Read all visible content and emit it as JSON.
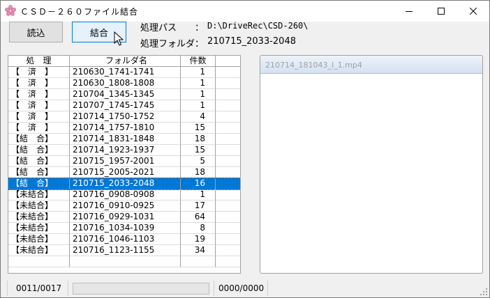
{
  "window": {
    "title": "ＣＳＤ－２６０ファイル結合",
    "icon": "sakura-flower-icon",
    "accent": "#0078d7"
  },
  "toolbar": {
    "load_label": "読込",
    "join_label": "結合"
  },
  "info": {
    "path_label": "処理パス　　：",
    "path_value": "D:\\DriveRec\\CSD-260\\",
    "folder_label": "処理フォルダ：",
    "folder_value": "210715_2033-2048"
  },
  "grid": {
    "headers": [
      "処　理",
      "フォルダ名",
      "件数",
      ""
    ],
    "selected_index": 10,
    "rows": [
      {
        "status": "【　済　】",
        "folder": "210630_1741-1741",
        "count": "1"
      },
      {
        "status": "【　済　】",
        "folder": "210630_1808-1808",
        "count": "1"
      },
      {
        "status": "【　済　】",
        "folder": "210704_1345-1345",
        "count": "1"
      },
      {
        "status": "【　済　】",
        "folder": "210707_1745-1745",
        "count": "1"
      },
      {
        "status": "【　済　】",
        "folder": "210714_1750-1752",
        "count": "4"
      },
      {
        "status": "【　済　】",
        "folder": "210714_1757-1810",
        "count": "15"
      },
      {
        "status": "【結　合】",
        "folder": "210714_1831-1848",
        "count": "18"
      },
      {
        "status": "【結　合】",
        "folder": "210714_1923-1937",
        "count": "15"
      },
      {
        "status": "【結　合】",
        "folder": "210715_1957-2001",
        "count": "5"
      },
      {
        "status": "【結　合】",
        "folder": "210715_2005-2021",
        "count": "18"
      },
      {
        "status": "【結　合】",
        "folder": "210715_2033-2048",
        "count": "16"
      },
      {
        "status": "【未結合】",
        "folder": "210716_0908-0908",
        "count": "1"
      },
      {
        "status": "【未結合】",
        "folder": "210716_0910-0925",
        "count": "17"
      },
      {
        "status": "【未結合】",
        "folder": "210716_0929-1031",
        "count": "64"
      },
      {
        "status": "【未結合】",
        "folder": "210716_1034-1039",
        "count": "8"
      },
      {
        "status": "【未結合】",
        "folder": "210716_1046-1103",
        "count": "19"
      },
      {
        "status": "【未結合】",
        "folder": "210716_1123-1155",
        "count": "34"
      },
      {
        "status": "",
        "folder": "",
        "count": ""
      }
    ]
  },
  "preview": {
    "title": "210714_181043_I_1.mp4"
  },
  "status": {
    "count": "0011/0017",
    "files": "0000/0000",
    "progress": 0
  }
}
